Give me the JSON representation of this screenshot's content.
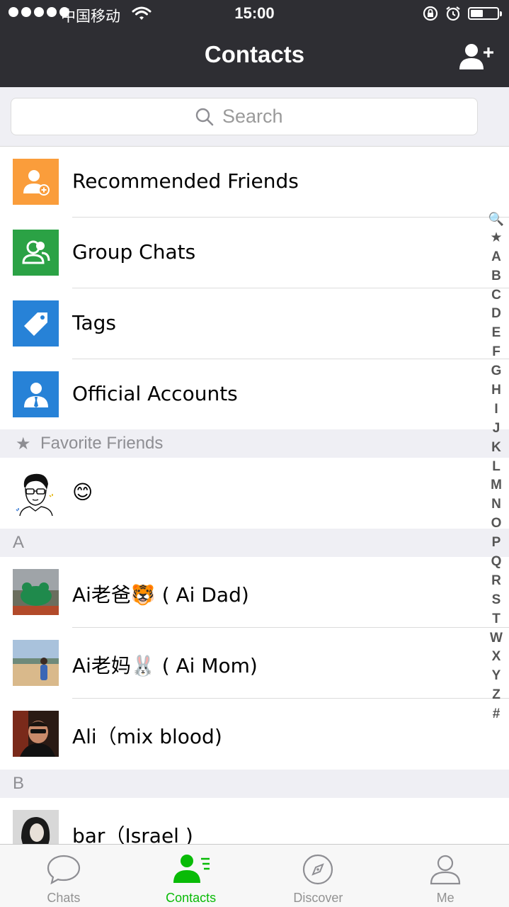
{
  "status_bar": {
    "carrier": "中国移动",
    "time": "15:00",
    "battery_level": 0.45
  },
  "nav": {
    "title": "Contacts"
  },
  "search": {
    "placeholder": "Search"
  },
  "functions": [
    {
      "label": "Recommended Friends",
      "icon": "add-friend-icon",
      "color": "#fa9d3b"
    },
    {
      "label": "Group Chats",
      "icon": "group-icon",
      "color": "#2ba245"
    },
    {
      "label": "Tags",
      "icon": "tag-icon",
      "color": "#2782d7"
    },
    {
      "label": "Official Accounts",
      "icon": "official-account-icon",
      "color": "#2782d7"
    }
  ],
  "favorites": {
    "header": "Favorite Friends",
    "contacts": [
      {
        "name": "😊"
      }
    ]
  },
  "groups": [
    {
      "letter": "A",
      "contacts": [
        {
          "name": "Ai老爸🐯 ( Ai Dad)"
        },
        {
          "name": "Ai老妈🐰 ( Ai Mom)"
        },
        {
          "name": "Ali（mix blood)"
        }
      ]
    },
    {
      "letter": "B",
      "contacts": [
        {
          "name": "bar（Israel )"
        }
      ]
    }
  ],
  "index": [
    "🔍",
    "★",
    "A",
    "B",
    "C",
    "D",
    "E",
    "F",
    "G",
    "H",
    "I",
    "J",
    "K",
    "L",
    "M",
    "N",
    "O",
    "P",
    "Q",
    "R",
    "S",
    "T",
    "W",
    "X",
    "Y",
    "Z",
    "#"
  ],
  "tabs": [
    {
      "label": "Chats",
      "icon": "chat-bubble-icon",
      "active": false
    },
    {
      "label": "Contacts",
      "icon": "contacts-icon",
      "active": true
    },
    {
      "label": "Discover",
      "icon": "compass-icon",
      "active": false
    },
    {
      "label": "Me",
      "icon": "person-icon",
      "active": false
    }
  ],
  "colors": {
    "accent": "#09bb07",
    "navbar": "#2e2e33",
    "section_bg": "#efeff4"
  }
}
